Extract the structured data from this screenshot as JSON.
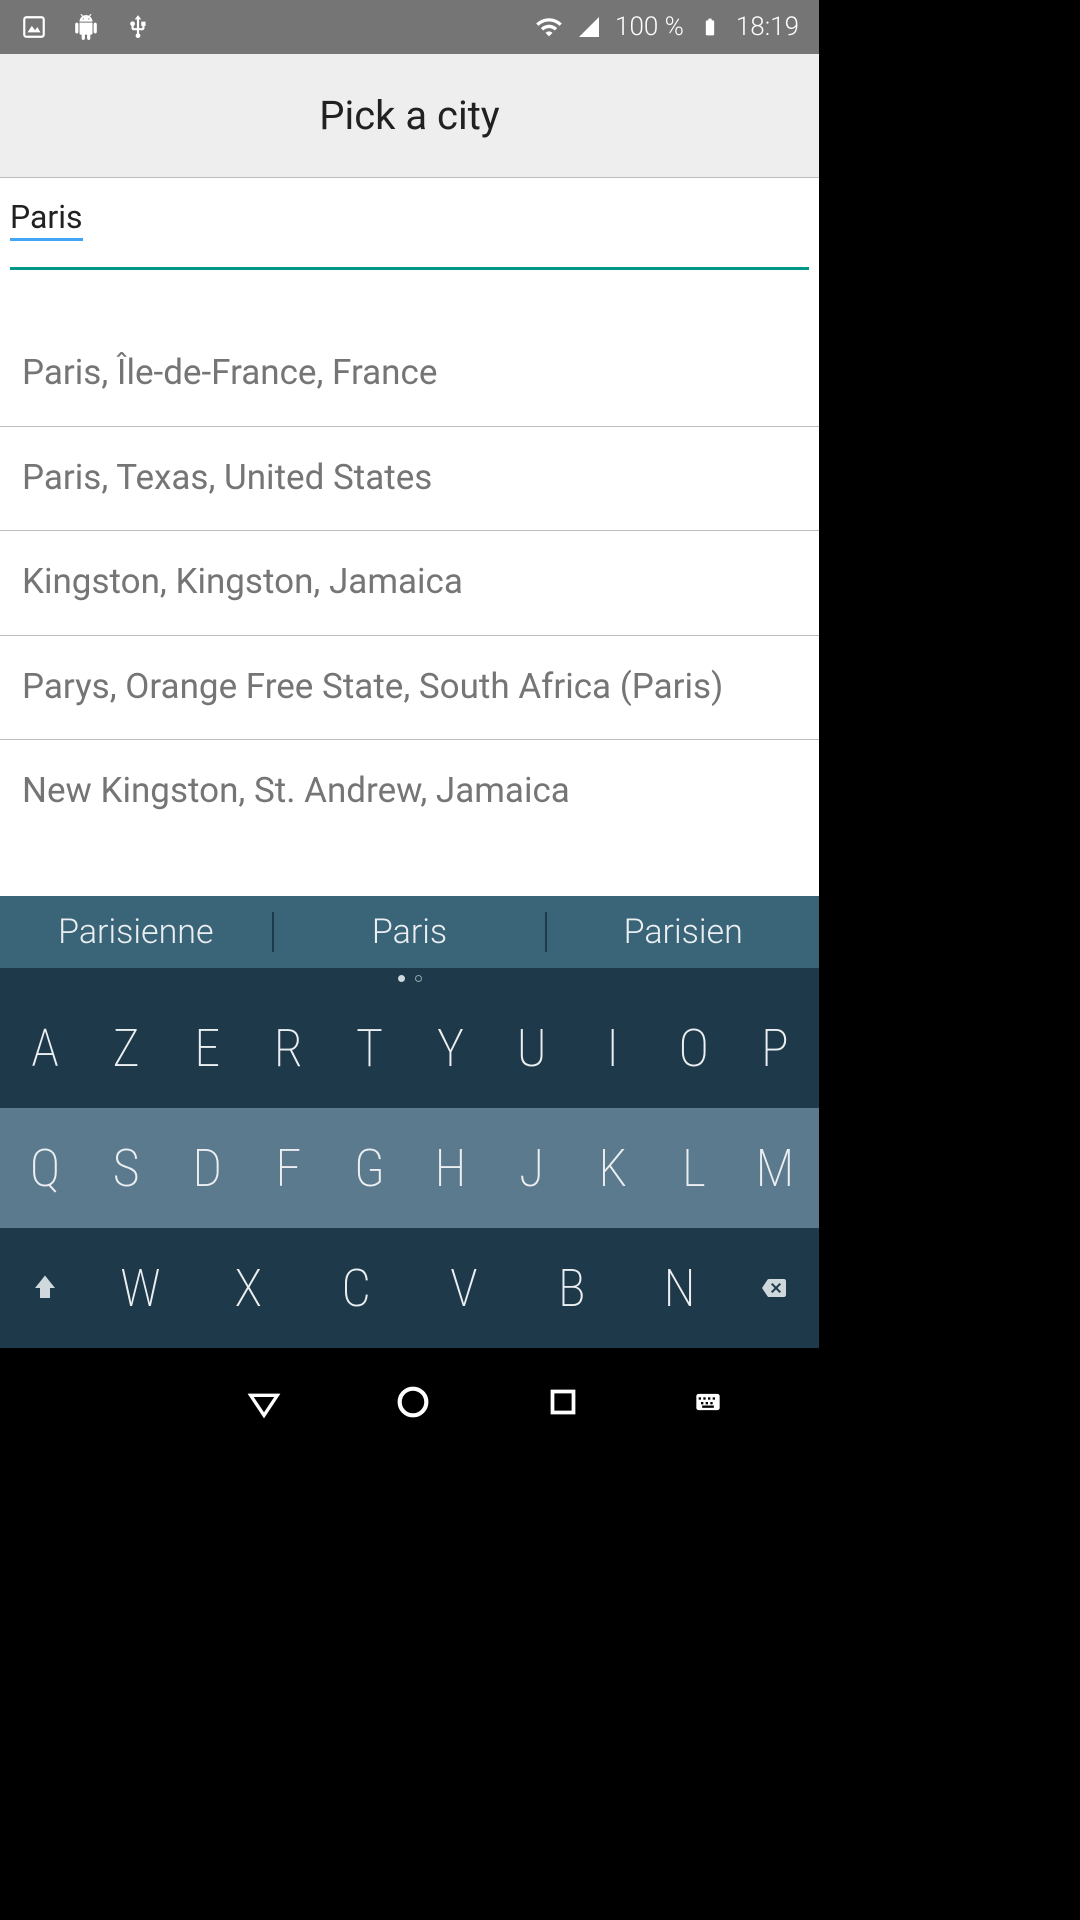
{
  "status_bar": {
    "battery_percent": "100 %",
    "time": "18:19"
  },
  "header": {
    "title": "Pick a city"
  },
  "search": {
    "value": "Paris"
  },
  "results": [
    "Paris, Île-de-France, France",
    "Paris, Texas, United States",
    "Kingston, Kingston, Jamaica",
    "Parys, Orange Free State, South Africa (Paris)",
    "New Kingston, St. Andrew, Jamaica"
  ],
  "keyboard": {
    "suggestions": [
      "Parisienne",
      "Paris",
      "Parisien"
    ],
    "row1": [
      "A",
      "Z",
      "E",
      "R",
      "T",
      "Y",
      "U",
      "I",
      "O",
      "P"
    ],
    "row2": [
      "Q",
      "S",
      "D",
      "F",
      "G",
      "H",
      "J",
      "K",
      "L",
      "M"
    ],
    "row3": [
      "W",
      "X",
      "C",
      "V",
      "B",
      "N"
    ]
  }
}
